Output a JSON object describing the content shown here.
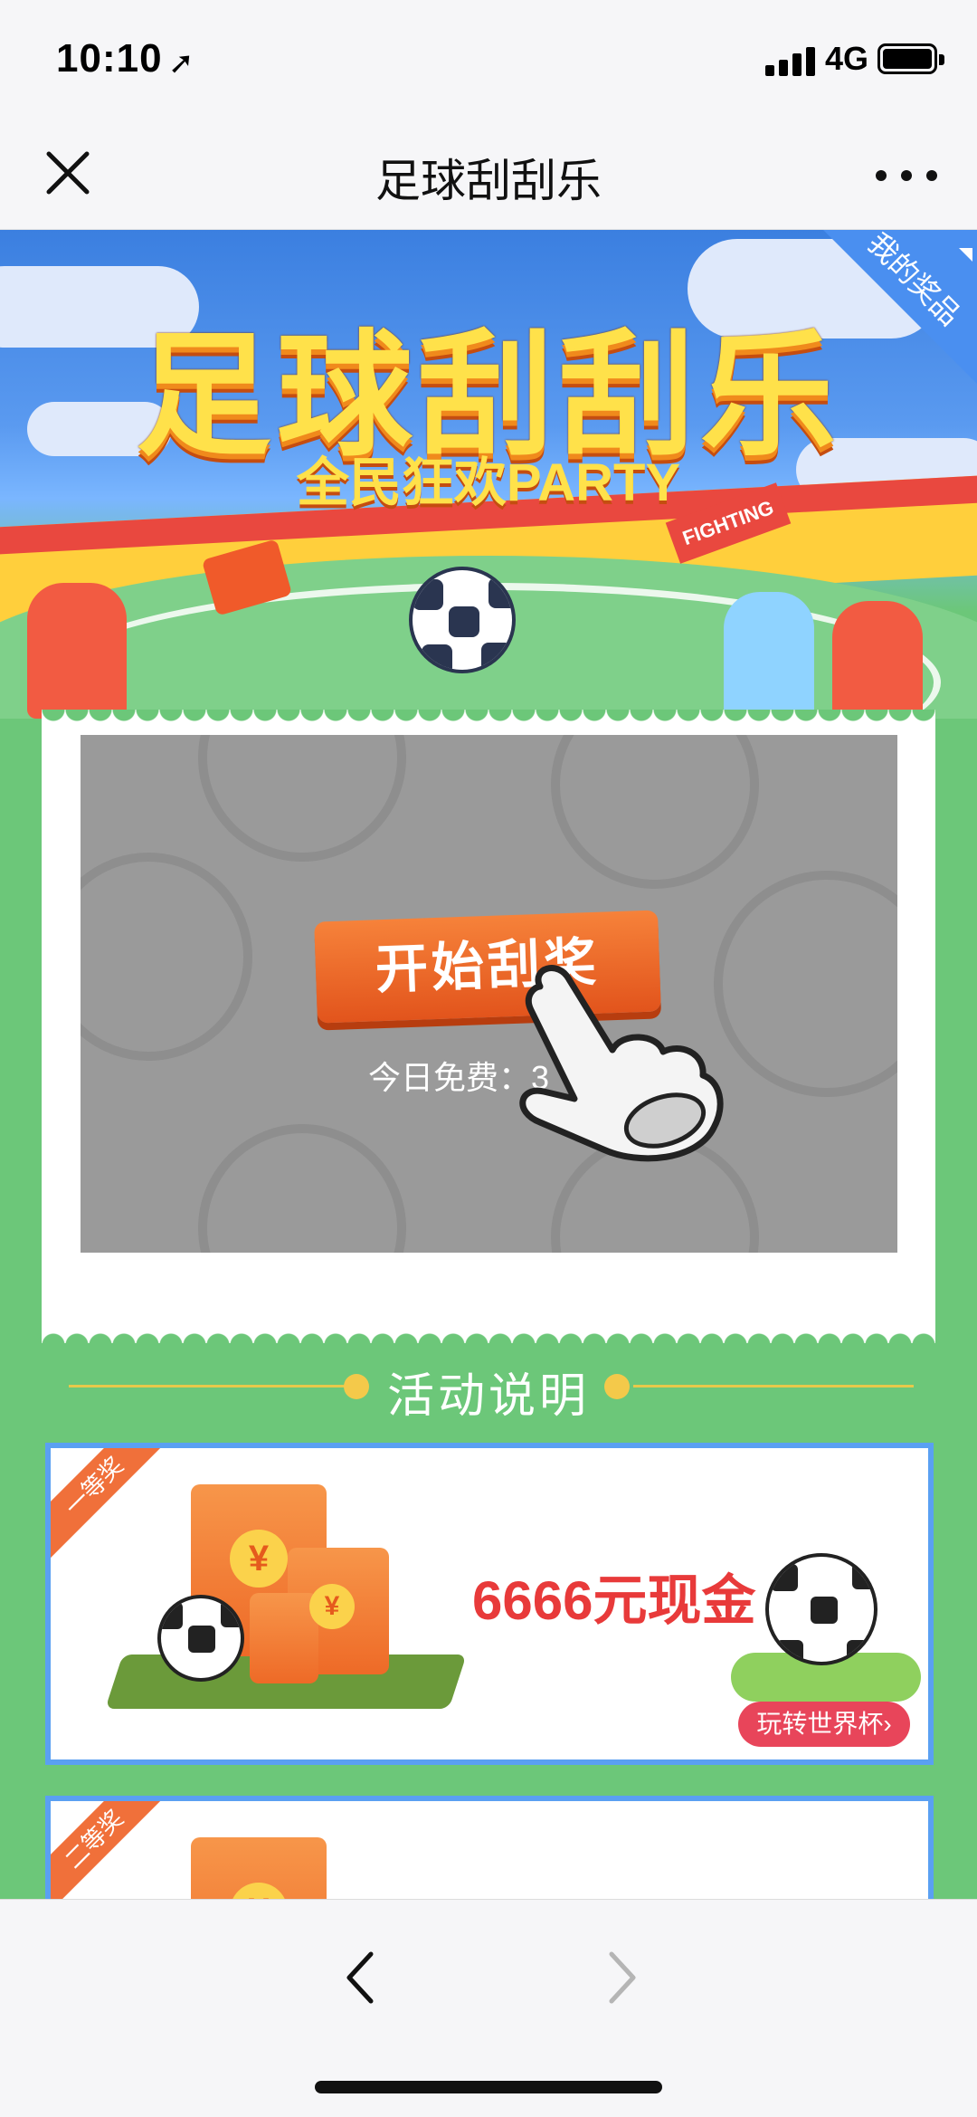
{
  "status_bar": {
    "time": "10:10",
    "network": "4G",
    "signal_bars": 4,
    "battery_level": 0.9
  },
  "nav": {
    "title": "足球刮刮乐",
    "close_icon": "close-icon",
    "more_icon": "more-icon"
  },
  "banner": {
    "logo_text": "足球刮刮乐",
    "subtitle": "全民狂欢PARTY",
    "my_prizes": "我的奖品",
    "fighting_flag": "FIGHTING"
  },
  "scratch_card": {
    "start_button": "开始刮奖",
    "free_today_label": "今日免费：",
    "free_today_value": "3"
  },
  "section": {
    "title": "活动说明"
  },
  "prizes": [
    {
      "rank": "一等奖",
      "amount": "6666元现金",
      "cta": "玩转世界杯›"
    },
    {
      "rank": "二等奖"
    }
  ],
  "colors": {
    "page_green": "#6cc779",
    "button_orange": "#e2541c",
    "prize_border": "#5aa0f2",
    "amount_red": "#e83a3a"
  }
}
